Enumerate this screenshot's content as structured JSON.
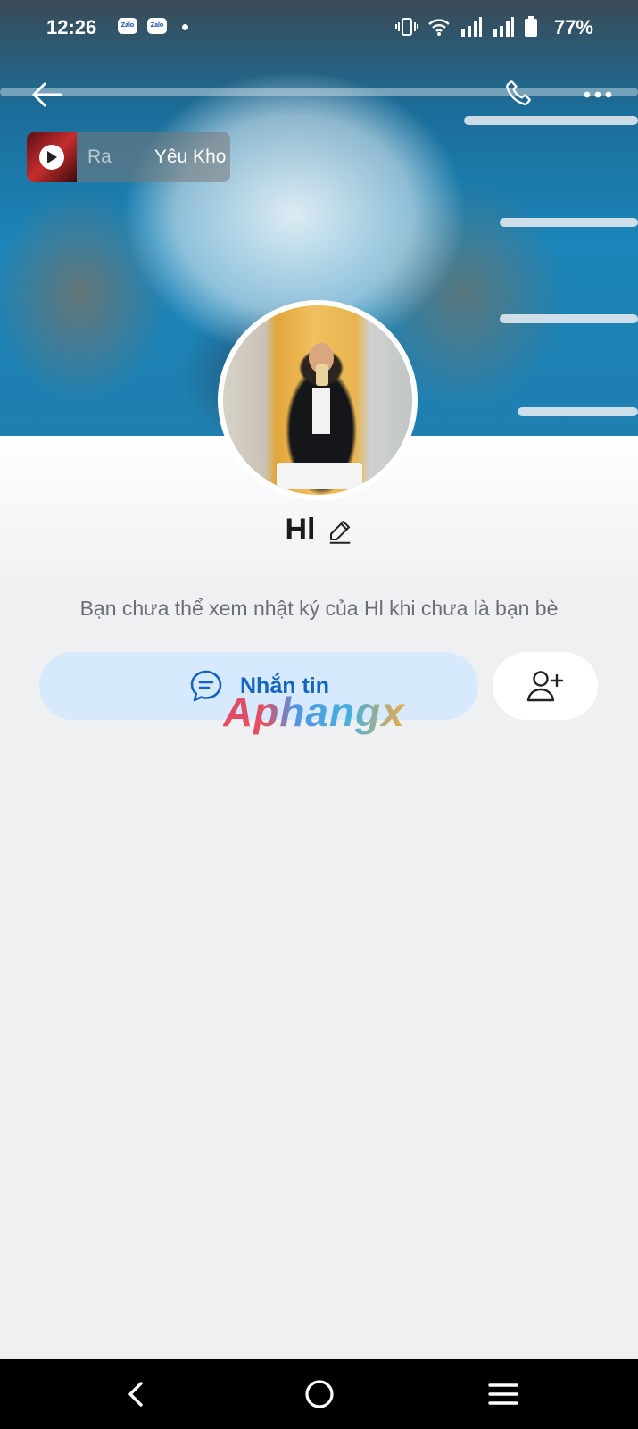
{
  "status_bar": {
    "time": "12:26",
    "notification_apps": [
      "Zalo",
      "Zalo"
    ],
    "battery": "77%"
  },
  "header": {
    "back_icon": "arrow-left-icon",
    "call_icon": "phone-icon",
    "more_icon": "more-dots-icon"
  },
  "music": {
    "title_partial": "Ra",
    "title": "Yêu Kho"
  },
  "profile": {
    "name": "Hl",
    "edit_icon": "pencil-icon",
    "info_text": "Bạn chưa thể xem nhật ký của Hl khi chưa là bạn bè"
  },
  "actions": {
    "message_label": "Nhắn tin",
    "message_icon": "chat-bubble-icon",
    "add_friend_icon": "add-user-icon"
  },
  "watermark": "Aphangx",
  "navigation": {
    "back_icon": "nav-back-icon",
    "home_icon": "nav-home-icon",
    "menu_icon": "nav-menu-icon"
  },
  "colors": {
    "accent": "#1565c0",
    "message_button_bg": "#d6e9fd",
    "page_bg": "#eef0f2"
  }
}
